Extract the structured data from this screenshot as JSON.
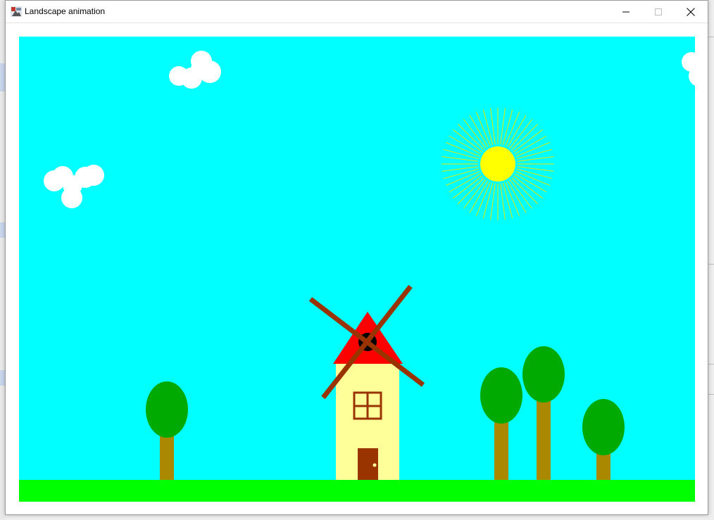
{
  "window": {
    "title": "Landscape animation",
    "controls": {
      "minimize": "minimize",
      "maximize": "maximize",
      "close": "close"
    }
  },
  "scene": {
    "sky_color": "#00FFFF",
    "ground_color": "#00FF00",
    "cloud_color": "#FFFFFF",
    "sun_color": "#FFFF00",
    "sun_ray_color": "#E6E600",
    "mill_body_color": "#FFFF99",
    "mill_roof_color": "#FF0000",
    "mill_trim_color": "#993300",
    "blade_color": "#993300",
    "hub_color": "#000000",
    "tree_crown_color": "#00AA00",
    "tree_trunk_color": "#AA8800"
  }
}
